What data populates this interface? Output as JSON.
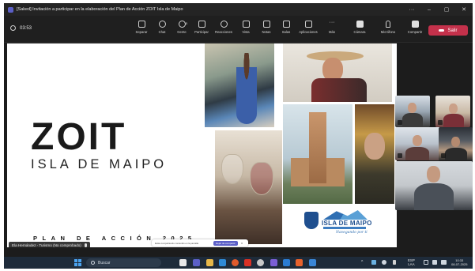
{
  "window": {
    "title": "[Saked] Invitación a participar en la elaboración del Plan de Acción ZOIT Isla de Maipo",
    "more": "···",
    "minimize": "–",
    "restore": "▢",
    "close": "✕"
  },
  "toolbar": {
    "timer": "03:53",
    "items": [
      {
        "label": "Separar",
        "icon": "pop-out-icon"
      },
      {
        "label": "Chat",
        "icon": "chat-icon"
      },
      {
        "label": "Gente",
        "icon": "people-icon",
        "badge": "5"
      },
      {
        "label": "Participar",
        "icon": "raise-hand-icon"
      },
      {
        "label": "Reacciones",
        "icon": "reactions-icon"
      },
      {
        "label": "Vista",
        "icon": "view-icon"
      },
      {
        "label": "Notas",
        "icon": "notes-icon"
      },
      {
        "label": "Salas",
        "icon": "rooms-icon"
      },
      {
        "label": "Aplicaciones",
        "icon": "apps-icon"
      },
      {
        "label": "Más",
        "icon": "more-icon"
      },
      {
        "label": "Cámara",
        "icon": "camera-icon"
      },
      {
        "label": "Micrófono",
        "icon": "mic-off-icon"
      },
      {
        "label": "Compartir",
        "icon": "share-icon"
      }
    ],
    "exit_label": "Salir"
  },
  "slide": {
    "title": "ZOIT",
    "subtitle": "ISLA DE MAIPO",
    "footer": "PLAN DE ACCIÓN 2025",
    "logo_name": "ISLA DE MAIPO",
    "logo_tagline": "Navegando por ti"
  },
  "presenter": {
    "name": "Ela Hernández - Turismo (No comprobado)"
  },
  "share_notice": {
    "text": "Estás compartiendo contenido en la pantalla",
    "stop_label": "Dejar de compartir",
    "close": "✕"
  },
  "taskbar": {
    "search_placeholder": "Buscar",
    "language": "ESP",
    "language_sub": "LAA",
    "time": "10:33",
    "date": "08-07-2025"
  },
  "colors": {
    "exit": "#c4314b",
    "accent": "#5b5fc7",
    "taskbar": "#1e2b3a"
  }
}
